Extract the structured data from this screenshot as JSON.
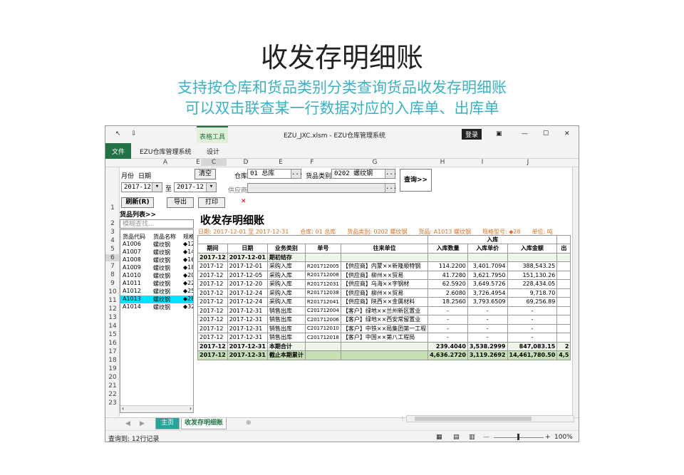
{
  "slide": {
    "title": "收发存明细账",
    "subtitle1": "支持按仓库和货品类别分类查询货品收发存明细账",
    "subtitle2": "可以双击联查某一行数据对应的入库单、出库单"
  },
  "window": {
    "title": "EZU_JXC.xlsm  -  EZU仓库管理系统",
    "context_tab": "表格工具",
    "login": "登录",
    "tabs": [
      "文件",
      "EZU仓库管理系统",
      "设计"
    ]
  },
  "columns": [
    "A",
    "B",
    "C",
    "D",
    "E",
    "F",
    "G",
    "H",
    "I",
    "J"
  ],
  "rows": [
    "1",
    "2",
    "3",
    "4",
    "5",
    "6",
    "7",
    "8",
    "9",
    "10",
    "11",
    "12",
    "13",
    "14",
    "15",
    "16",
    "17",
    "18",
    "19",
    "20",
    "21",
    "22",
    "23"
  ],
  "form": {
    "month_label": "月份",
    "date_label": "日期",
    "clear": "清空",
    "from": "2017-12",
    "to_label": "至",
    "to": "2017-12",
    "warehouse_label": "仓库",
    "warehouse": "01 总库",
    "category_label": "货品类别",
    "category": "0202 螺纹钢",
    "supplier_label": "供应商",
    "supplier": "",
    "query": "查询>>",
    "refresh": "刷新(R)",
    "export": "导出",
    "print": "打印",
    "close": "✕",
    "list_title": "货品列表>>",
    "search_placeholder": "模糊查找...",
    "ellipsis": "..."
  },
  "product_list": {
    "headers": [
      "货品代码",
      "货品名称",
      "规格"
    ],
    "rows": [
      [
        "A1006",
        "螺纹钢",
        "◆12"
      ],
      [
        "A1007",
        "螺纹钢",
        "◆14"
      ],
      [
        "A1008",
        "螺纹钢",
        "◆16"
      ],
      [
        "A1009",
        "螺纹钢",
        "◆18"
      ],
      [
        "A1010",
        "螺纹钢",
        "◆20"
      ],
      [
        "A1011",
        "螺纹钢",
        "◆22"
      ],
      [
        "A1012",
        "螺纹钢",
        "◆25"
      ],
      [
        "A1013",
        "螺纹钢",
        "◆28"
      ],
      [
        "A1014",
        "螺纹钢",
        "◆32"
      ]
    ],
    "selected_index": 7
  },
  "report": {
    "title": "收发存明细账",
    "info": "日期: 2017-12-01 至 2017-12-31　　仓库: 01 总库　　货品类别: 0202 螺纹钢　　货品: A1013 螺纹钢　　规格型号: ◆28　　单位: 吨",
    "group_header": "入库",
    "headers": [
      "期间",
      "日期",
      "业务类别",
      "单号",
      "往来单位",
      "入库数量",
      "入库单价",
      "入库金额",
      "出"
    ],
    "rows": [
      [
        "2017-12",
        "2017-12-01",
        "期初结存",
        "",
        "",
        "",
        "",
        "",
        ""
      ],
      [
        "2017-12",
        "2017-12-01",
        "采购入库",
        "R201712005",
        "【供应商】内蒙××新隆顺特钢",
        "114.2200",
        "3,401.7094",
        "388,543.25",
        ""
      ],
      [
        "2017-12",
        "2017-12-05",
        "采购入库",
        "R201712008",
        "【供应商】柳州××贸易",
        "41.7280",
        "3,621.7950",
        "151,130.26",
        ""
      ],
      [
        "2017-12",
        "2017-12-20",
        "采购入库",
        "R201712031",
        "【供应商】乌海××字钢材",
        "62.5920",
        "3,649.5726",
        "228,434.05",
        ""
      ],
      [
        "2017-12",
        "2017-12-24",
        "采购入库",
        "R201712038",
        "【供应商】柳州××贸易",
        "2.6080",
        "3,726.4954",
        "9,718.70",
        ""
      ],
      [
        "2017-12",
        "2017-12-24",
        "采购入库",
        "R201712041",
        "【供应商】陕西××金属材料",
        "18.2560",
        "3,793.6509",
        "69,256.89",
        ""
      ],
      [
        "2017-12",
        "2017-12-31",
        "销售出库",
        "C201712004",
        "【客户】绿地××兰州新区置业",
        "-",
        "-",
        "-",
        ""
      ],
      [
        "2017-12",
        "2017-12-31",
        "销售出库",
        "C201712006",
        "【客户】绿地××西安常留置业",
        "-",
        "-",
        "-",
        ""
      ],
      [
        "2017-12",
        "2017-12-31",
        "销售出库",
        "C201712010",
        "【客户】中铁××局集团第一工程",
        "-",
        "-",
        "-",
        ""
      ],
      [
        "2017-12",
        "2017-12-31",
        "销售出库",
        "C201712018",
        "【客户】中国××第八工程局",
        "-",
        "-",
        "-",
        ""
      ],
      [
        "2017-12",
        "2017-12-31",
        "本期合计",
        "",
        "",
        "239.4040",
        "3,538.2999",
        "847,083.15",
        "2"
      ],
      [
        "2017-12",
        "2017-12-31",
        "截止本期累计",
        "",
        "",
        "4,636.2720",
        "3,119.2692",
        "14,461,780.50",
        "4,5"
      ]
    ]
  },
  "sheet_tabs": [
    "主页",
    "收发存明细账"
  ],
  "status": {
    "text": "查询到: 12行记录",
    "zoom": "100%"
  }
}
